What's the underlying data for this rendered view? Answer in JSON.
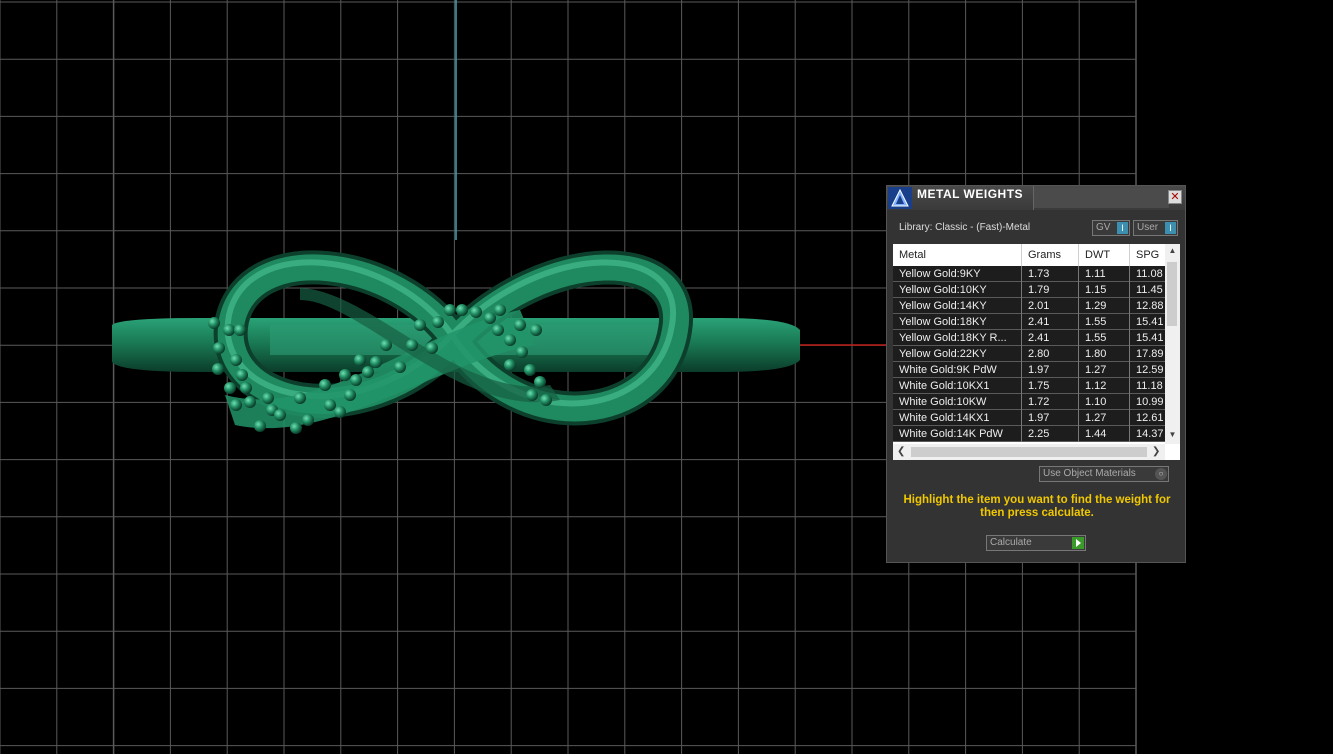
{
  "panel": {
    "title": "METAL WEIGHTS",
    "close_symbol": "✕",
    "library_label": "Library: Classic - (Fast)-Metal",
    "gv_label": "GV",
    "user_label": "User",
    "toggle_indicator": "I",
    "columns": [
      "Metal",
      "Grams",
      "DWT",
      "SPG"
    ],
    "rows": [
      {
        "metal": "Yellow Gold:9KY",
        "grams": "1.73",
        "dwt": "1.11",
        "spg": "11.08"
      },
      {
        "metal": "Yellow Gold:10KY",
        "grams": "1.79",
        "dwt": "1.15",
        "spg": "11.45"
      },
      {
        "metal": "Yellow Gold:14KY",
        "grams": "2.01",
        "dwt": "1.29",
        "spg": "12.88"
      },
      {
        "metal": "Yellow Gold:18KY",
        "grams": "2.41",
        "dwt": "1.55",
        "spg": "15.41"
      },
      {
        "metal": "Yellow Gold:18KY R...",
        "grams": "2.41",
        "dwt": "1.55",
        "spg": "15.41"
      },
      {
        "metal": "Yellow Gold:22KY",
        "grams": "2.80",
        "dwt": "1.80",
        "spg": "17.89"
      },
      {
        "metal": "White Gold:9K PdW",
        "grams": "1.97",
        "dwt": "1.27",
        "spg": "12.59"
      },
      {
        "metal": "White Gold:10KX1",
        "grams": "1.75",
        "dwt": "1.12",
        "spg": "11.18"
      },
      {
        "metal": "White Gold:10KW",
        "grams": "1.72",
        "dwt": "1.10",
        "spg": "10.99"
      },
      {
        "metal": "White Gold:14KX1",
        "grams": "1.97",
        "dwt": "1.27",
        "spg": "12.61"
      },
      {
        "metal": "White Gold:14K PdW",
        "grams": "2.25",
        "dwt": "1.44",
        "spg": "14.37"
      }
    ],
    "material_select": "Use Object Materials",
    "hint": "Highlight the item you want to find the weight for then press calculate.",
    "calculate_label": "Calculate"
  },
  "colors": {
    "background": "#000000",
    "grid": "#5a5a5a",
    "axis_y": "#3fa9b5",
    "axis_x": "#c0201a",
    "model": "#1f8a60",
    "hint_text": "#f0c800"
  }
}
